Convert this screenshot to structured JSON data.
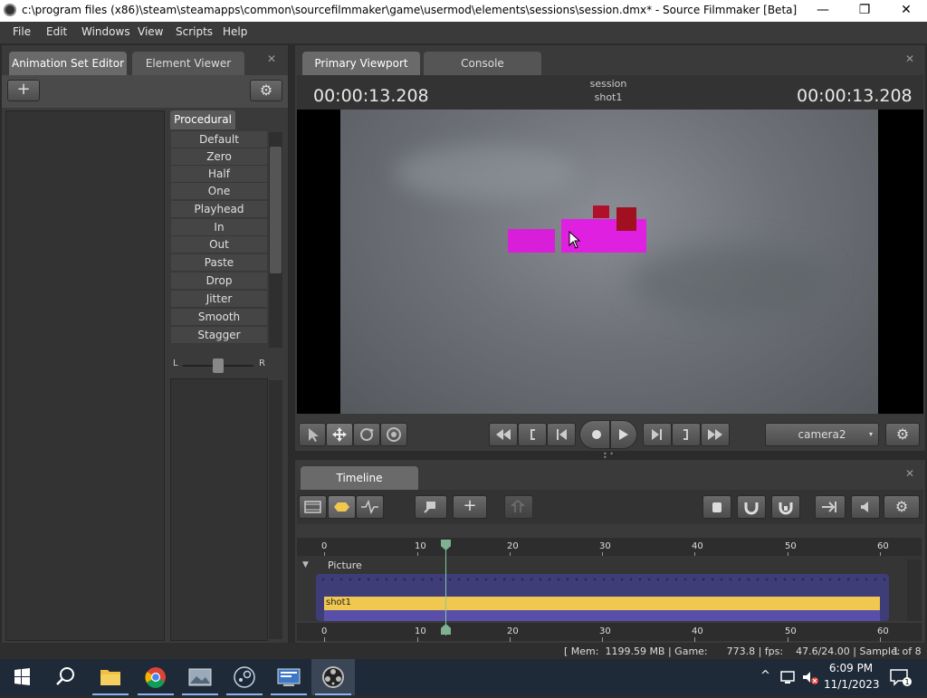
{
  "window": {
    "title": "c:\\program files (x86)\\steam\\steamapps\\common\\sourcefilmmaker\\game\\usermod\\elements\\sessions\\session.dmx* - Source Filmmaker [Beta]",
    "minimize": "—",
    "maximize": "❐",
    "close": "✕"
  },
  "menu": [
    "File",
    "Edit",
    "Windows",
    "View",
    "Scripts",
    "Help"
  ],
  "left_panel": {
    "tabs": [
      "Animation Set Editor",
      "Element Viewer"
    ],
    "add_label": "+",
    "gear_label": "⚙",
    "procedural_tab": "Procedural",
    "procedural_items": [
      "Default",
      "Zero",
      "Half",
      "One",
      "Playhead",
      "In",
      "Out",
      "Paste",
      "Drop",
      "Jitter",
      "Smooth",
      "Stagger"
    ],
    "slider_left": "L",
    "slider_right": "R",
    "close": "✕"
  },
  "viewport": {
    "tabs": [
      "Primary Viewport",
      "Console"
    ],
    "time_left": "00:00:13.208",
    "time_right": "00:00:13.208",
    "session": "session",
    "shot": "shot1",
    "camera": "camera2",
    "close": "✕"
  },
  "timeline": {
    "tab": "Timeline",
    "ruler_ticks": [
      "0",
      "10",
      "20",
      "30",
      "40",
      "50",
      "60"
    ],
    "track_label": "Picture",
    "clip_label": "shot1",
    "close": "✕"
  },
  "status": {
    "text": "[ Mem:  1199.59 MB | Game:      773.8 | fps:    47.6/24.00 | Sample:",
    "sample": "1 of 8 ]"
  },
  "taskbar": {
    "time": "6:09 PM",
    "date": "11/1/2023",
    "chevron": "^"
  },
  "colors": {
    "accent": "#f0c850",
    "magenta": "#e020e0"
  }
}
